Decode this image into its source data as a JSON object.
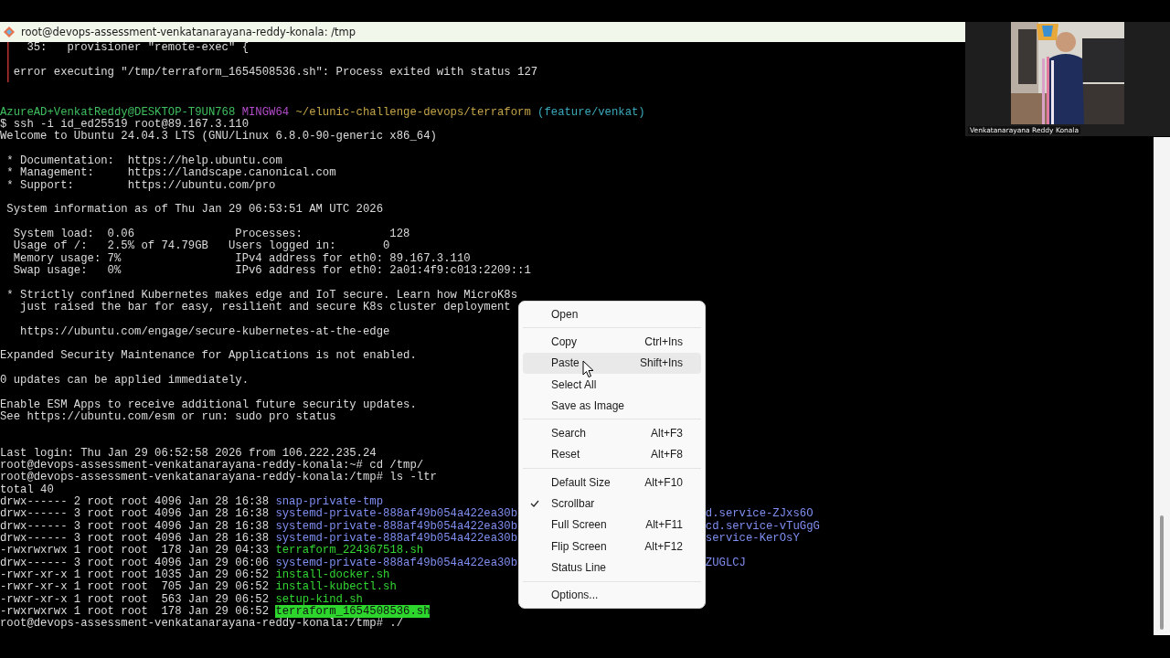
{
  "window": {
    "title": "root@devops-assessment-venkatanarayana-reddy-konala: /tmp"
  },
  "error_output": [
    {
      "segments": [
        {
          "text": "    35:   provisioner \"remote-exec\" {",
          "kind": "plain"
        }
      ]
    },
    {
      "gap_before": true,
      "segments": [
        {
          "text": "  error executing \"/tmp/terraform_1654508536.sh\": Process exited with status 127",
          "kind": "plain"
        }
      ]
    }
  ],
  "lines": [
    {
      "gap_before": true,
      "double_gap": true,
      "segments": [
        {
          "text": "AzureAD+VenkatReddy@DESKTOP-T9UN768",
          "kind": "user"
        },
        {
          "text": "MINGW64",
          "kind": "shell"
        },
        {
          "text": "~/elunic-challenge-devops/terraform",
          "kind": "path"
        },
        {
          "text": "(feature/venkat)",
          "kind": "branch"
        }
      ]
    },
    {
      "segments": [
        {
          "text": "$ ssh -i id_ed25519 root@89.167.3.110",
          "kind": "plain"
        }
      ]
    },
    {
      "segments": [
        {
          "text": "Welcome to Ubuntu 24.04.3 LTS (GNU/Linux 6.8.0-90-generic x86_64)",
          "kind": "plain"
        }
      ]
    },
    {
      "gap_before": true,
      "segments": [
        {
          "text": " * Documentation:  https://help.ubuntu.com",
          "kind": "plain"
        }
      ]
    },
    {
      "segments": [
        {
          "text": " * Management:     https://landscape.canonical.com",
          "kind": "plain"
        }
      ]
    },
    {
      "segments": [
        {
          "text": " * Support:        https://ubuntu.com/pro",
          "kind": "plain"
        }
      ]
    },
    {
      "gap_before": true,
      "segments": [
        {
          "text": " System information as of Thu Jan 29 06:53:51 AM UTC 2026",
          "kind": "plain"
        }
      ]
    },
    {
      "gap_before": true,
      "segments": [
        {
          "text": "  System load:  0.06               Processes:             128",
          "kind": "plain"
        }
      ]
    },
    {
      "segments": [
        {
          "text": "  Usage of /:   2.5% of 74.79GB   Users logged in:       0",
          "kind": "plain"
        }
      ]
    },
    {
      "segments": [
        {
          "text": "  Memory usage: 7%                 IPv4 address for eth0: 89.167.3.110",
          "kind": "plain"
        }
      ]
    },
    {
      "segments": [
        {
          "text": "  Swap usage:   0%                 IPv6 address for eth0: 2a01:4f9:c013:2209::1",
          "kind": "plain"
        }
      ]
    },
    {
      "gap_before": true,
      "segments": [
        {
          "text": " * Strictly confined Kubernetes makes edge and IoT secure. Learn how MicroK8s",
          "kind": "plain"
        }
      ]
    },
    {
      "segments": [
        {
          "text": "   just raised the bar for easy, resilient and secure K8s cluster deployment",
          "kind": "plain"
        }
      ]
    },
    {
      "gap_before": true,
      "segments": [
        {
          "text": "   https://ubuntu.com/engage/secure-kubernetes-at-the-edge",
          "kind": "plain"
        }
      ]
    },
    {
      "gap_before": true,
      "segments": [
        {
          "text": "Expanded Security Maintenance for Applications is not enabled.",
          "kind": "plain"
        }
      ]
    },
    {
      "gap_before": true,
      "segments": [
        {
          "text": "0 updates can be applied immediately.",
          "kind": "plain"
        }
      ]
    },
    {
      "gap_before": true,
      "segments": [
        {
          "text": "Enable ESM Apps to receive additional future security updates.",
          "kind": "plain"
        }
      ]
    },
    {
      "segments": [
        {
          "text": "See https://ubuntu.com/esm or run: sudo pro status",
          "kind": "plain"
        }
      ]
    },
    {
      "gap_before": true,
      "double_gap": true,
      "segments": [
        {
          "text": "Last login: Thu Jan 29 06:52:58 2026 from 106.222.235.24",
          "kind": "plain"
        }
      ]
    },
    {
      "segments": [
        {
          "text": "root@devops-assessment-venkatanarayana-reddy-konala:~# cd /tmp/",
          "kind": "plain"
        }
      ]
    },
    {
      "segments": [
        {
          "text": "root@devops-assessment-venkatanarayana-reddy-konala:/tmp# ls -ltr",
          "kind": "plain"
        }
      ]
    },
    {
      "segments": [
        {
          "text": "total 40",
          "kind": "plain"
        }
      ]
    },
    {
      "segments": [
        {
          "text": "drwx------ 2 root root 4096 Jan 28 16:38 ",
          "kind": "plain"
        },
        {
          "text": "snap-private-tmp",
          "kind": "dir"
        }
      ]
    },
    {
      "segments": [
        {
          "text": "drwx------ 3 root root 4096 Jan 28 16:38 ",
          "kind": "plain"
        },
        {
          "text": "systemd-private-888af49b054a422ea30b",
          "kind": "dir"
        },
        {
          "text": "d.service-ZJxs6O",
          "kind": "dir_tail"
        }
      ]
    },
    {
      "segments": [
        {
          "text": "drwx------ 3 root root 4096 Jan 28 16:38 ",
          "kind": "plain"
        },
        {
          "text": "systemd-private-888af49b054a422ea30b",
          "kind": "dir"
        },
        {
          "text": "cd.service-vTuGgG",
          "kind": "dir_tail"
        }
      ]
    },
    {
      "segments": [
        {
          "text": "drwx------ 3 root root 4096 Jan 28 16:38 ",
          "kind": "plain"
        },
        {
          "text": "systemd-private-888af49b054a422ea30b",
          "kind": "dir"
        },
        {
          "text": "service-KerOsY",
          "kind": "dir_tail"
        }
      ]
    },
    {
      "segments": [
        {
          "text": "-rwxrwxrwx 1 root root  178 Jan 29 04:33 ",
          "kind": "plain"
        },
        {
          "text": "terraform_224367518.sh",
          "kind": "exec"
        }
      ]
    },
    {
      "segments": [
        {
          "text": "drwx------ 3 root root 4096 Jan 29 06:06 ",
          "kind": "plain"
        },
        {
          "text": "systemd-private-888af49b054a422ea30b",
          "kind": "dir"
        },
        {
          "text": "ZUGLCJ",
          "kind": "dir_tail"
        }
      ]
    },
    {
      "segments": [
        {
          "text": "-rwxr-xr-x 1 root root 1035 Jan 29 06:52 ",
          "kind": "plain"
        },
        {
          "text": "install-docker.sh",
          "kind": "exec"
        }
      ]
    },
    {
      "segments": [
        {
          "text": "-rwxr-xr-x 1 root root  705 Jan 29 06:52 ",
          "kind": "plain"
        },
        {
          "text": "install-kubectl.sh",
          "kind": "exec"
        }
      ]
    },
    {
      "segments": [
        {
          "text": "-rwxr-xr-x 1 root root  563 Jan 29 06:52 ",
          "kind": "plain"
        },
        {
          "text": "setup-kind.sh",
          "kind": "exec"
        }
      ]
    },
    {
      "segments": [
        {
          "text": "-rwxrwxrwx 1 root root  178 Jan 29 06:52 ",
          "kind": "plain"
        },
        {
          "text": "terraform_1654508536.sh",
          "kind": "exec_highlight"
        }
      ]
    },
    {
      "segments": [
        {
          "text": "root@devops-assessment-venkatanarayana-reddy-konala:/tmp# ./",
          "kind": "plain"
        }
      ]
    }
  ],
  "context_menu": [
    {
      "kind": "item",
      "label": "Open",
      "checked": false,
      "selected": false
    },
    {
      "kind": "separator"
    },
    {
      "kind": "item",
      "label": "Copy",
      "shortcut": "Ctrl+Ins",
      "checked": false,
      "selected": false
    },
    {
      "kind": "item",
      "label": "Paste",
      "shortcut": "Shift+Ins",
      "checked": false,
      "selected": true
    },
    {
      "kind": "item",
      "label": "Select All",
      "checked": false,
      "selected": false
    },
    {
      "kind": "item",
      "label": "Save as Image",
      "checked": false,
      "selected": false
    },
    {
      "kind": "separator"
    },
    {
      "kind": "item",
      "label": "Search",
      "shortcut": "Alt+F3",
      "checked": false,
      "selected": false
    },
    {
      "kind": "item",
      "label": "Reset",
      "shortcut": "Alt+F8",
      "checked": false,
      "selected": false
    },
    {
      "kind": "separator"
    },
    {
      "kind": "item",
      "label": "Default Size",
      "shortcut": "Alt+F10",
      "checked": false,
      "selected": false
    },
    {
      "kind": "item",
      "label": "Scrollbar",
      "checked": true,
      "selected": false
    },
    {
      "kind": "item",
      "label": "Full Screen",
      "shortcut": "Alt+F11",
      "checked": false,
      "selected": false
    },
    {
      "kind": "item",
      "label": "Flip Screen",
      "shortcut": "Alt+F12",
      "checked": false,
      "selected": false
    },
    {
      "kind": "item",
      "label": "Status Line",
      "checked": false,
      "selected": false
    },
    {
      "kind": "separator"
    },
    {
      "kind": "item",
      "label": "Options...",
      "checked": false,
      "selected": false
    }
  ],
  "video_tile": {
    "kind": "picture",
    "name": "Venkatanarayana Reddy Konala"
  }
}
